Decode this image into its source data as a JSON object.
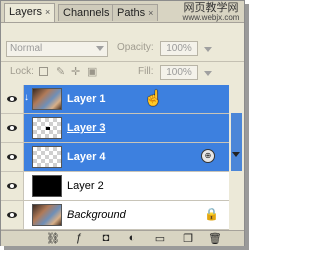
{
  "tabs": [
    {
      "label": "Layers",
      "active": true
    },
    {
      "label": "Channels",
      "active": false
    },
    {
      "label": "Paths",
      "active": false
    }
  ],
  "close_glyph": "×",
  "watermark": {
    "line1": "网页教学网",
    "line2": "www.webjx.com"
  },
  "blend_mode": {
    "value": "Normal"
  },
  "opacity": {
    "label": "Opacity:",
    "value": "100%"
  },
  "lock": {
    "label": "Lock:"
  },
  "fill": {
    "label": "Fill:",
    "value": "100%"
  },
  "layers": [
    {
      "name": "Layer 1",
      "thumb": "photo",
      "selected": true,
      "clipped": true,
      "style": "normal"
    },
    {
      "name": "Layer 3",
      "thumb": "checker",
      "selected": true,
      "clipped": false,
      "style": "underline"
    },
    {
      "name": "Layer 4",
      "thumb": "checker",
      "selected": true,
      "clipped": false,
      "style": "normal",
      "smart_object": true
    },
    {
      "name": "Layer 2",
      "thumb": "black",
      "selected": false,
      "clipped": false,
      "style": "normal"
    },
    {
      "name": "Background",
      "thumb": "photo",
      "selected": false,
      "clipped": false,
      "style": "italic",
      "locked": true
    }
  ],
  "bottom_icons": [
    "link-icon",
    "fx-icon",
    "mask-icon",
    "adjustment-icon",
    "group-icon",
    "new-layer-icon",
    "trash-icon"
  ],
  "colors": {
    "selection": "#3d80df",
    "panel": "#ece9d8"
  }
}
